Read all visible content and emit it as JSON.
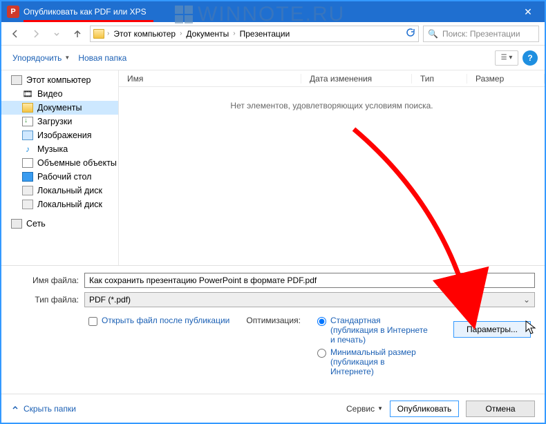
{
  "title": "Опубликовать как PDF или XPS",
  "watermark": "WINNOTE.RU",
  "breadcrumbs": {
    "root": "Этот компьютер",
    "docs": "Документы",
    "folder": "Презентации"
  },
  "search_placeholder": "Поиск: Презентации",
  "toolbar": {
    "organize": "Упорядочить",
    "new_folder": "Новая папка"
  },
  "columns": {
    "name": "Имя",
    "modified": "Дата изменения",
    "type": "Тип",
    "size": "Размер"
  },
  "empty_msg": "Нет элементов, удовлетворяющих условиям поиска.",
  "sidebar": {
    "this_pc": "Этот компьютер",
    "video": "Видео",
    "documents": "Документы",
    "downloads": "Загрузки",
    "pictures": "Изображения",
    "music": "Музыка",
    "objects3d": "Объемные объекты",
    "desktop": "Рабочий стол",
    "disk1": "Локальный диск",
    "disk2": "Локальный диск",
    "network": "Сеть"
  },
  "labels": {
    "filename": "Имя файла:",
    "filetype": "Тип файла:"
  },
  "filename": "Как сохранить презентацию PowerPoint в формате PDF.pdf",
  "filetype": "PDF (*.pdf)",
  "open_after": "Открыть файл после публикации",
  "optimize": {
    "title": "Оптимизация:",
    "standard": "Стандартная (публикация в Интернете и печать)",
    "minimal": "Минимальный размер (публикация в Интернете)"
  },
  "params_btn": "Параметры...",
  "hide_folders": "Скрыть папки",
  "tools": "Сервис",
  "publish": "Опубликовать",
  "cancel": "Отмена"
}
